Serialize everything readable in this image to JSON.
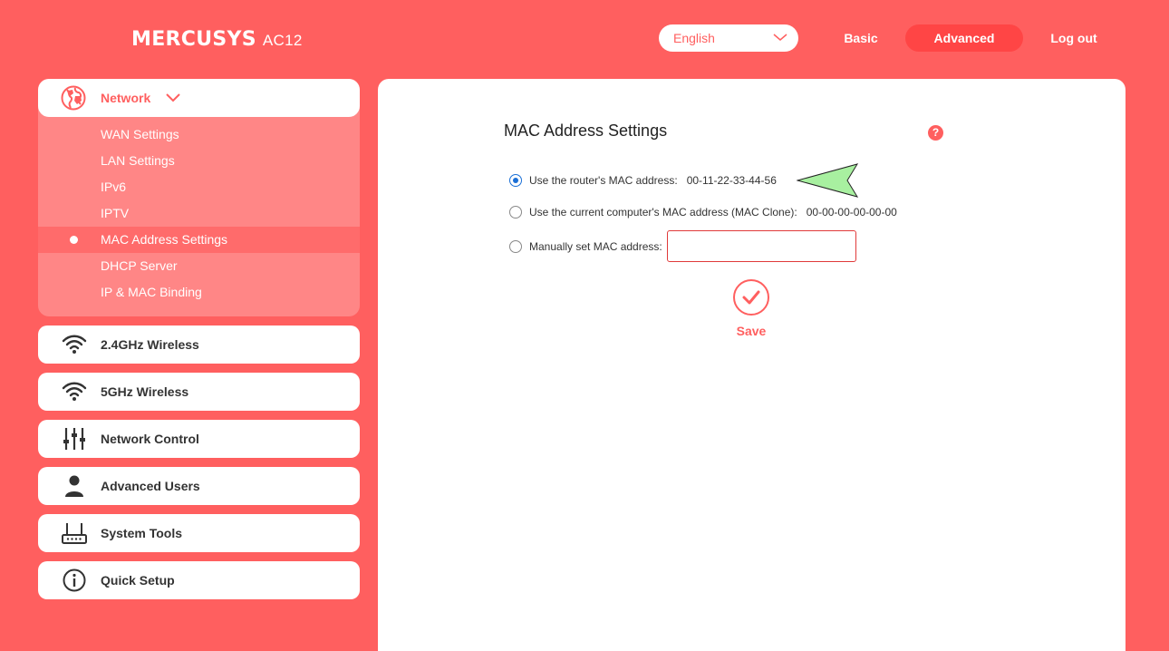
{
  "header": {
    "brand": "MERCUSYS",
    "model": "AC12",
    "language": "English",
    "nav": {
      "basic": "Basic",
      "advanced": "Advanced",
      "logout": "Log out"
    }
  },
  "sidebar": {
    "network": {
      "label": "Network",
      "icon": "globe-icon",
      "items": [
        "WAN Settings",
        "LAN Settings",
        "IPv6",
        "IPTV",
        "MAC Address Settings",
        "DHCP Server",
        "IP & MAC Binding"
      ],
      "active_index": 4
    },
    "menu": [
      {
        "label": "2.4GHz Wireless",
        "icon": "wifi-icon"
      },
      {
        "label": "5GHz Wireless",
        "icon": "wifi-icon"
      },
      {
        "label": "Network Control",
        "icon": "sliders-icon"
      },
      {
        "label": "Advanced Users",
        "icon": "user-icon"
      },
      {
        "label": "System Tools",
        "icon": "router-icon"
      },
      {
        "label": "Quick Setup",
        "icon": "info-icon"
      }
    ]
  },
  "main": {
    "title": "MAC Address Settings",
    "help": "?",
    "options": {
      "router": {
        "label": "Use the router's MAC address:",
        "value": "00-11-22-33-44-56",
        "checked": true
      },
      "clone": {
        "label": "Use the current computer's MAC address (MAC Clone):",
        "value": "00-00-00-00-00-00",
        "checked": false
      },
      "manual": {
        "label": "Manually set MAC address:",
        "value": "",
        "checked": false
      }
    },
    "save_label": "Save"
  },
  "colors": {
    "brand": "#ff5f5f",
    "accent_active": "#ff4545",
    "radio_checked": "#1a6fd6",
    "annotation_arrow": "#a8f0a0"
  }
}
